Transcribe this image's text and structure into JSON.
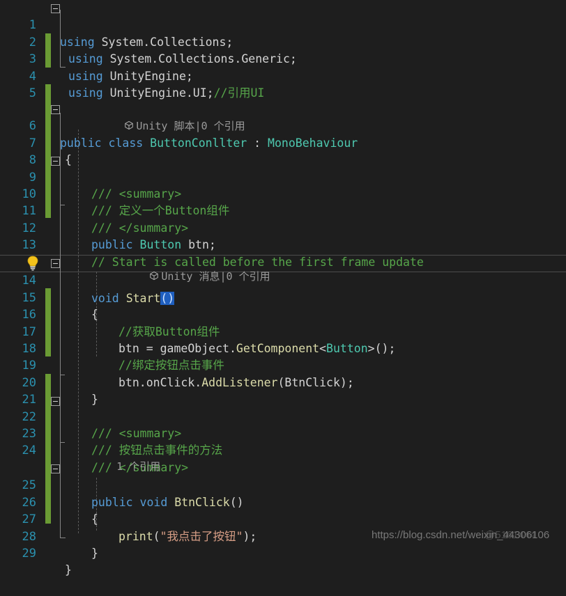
{
  "editor": {
    "theme": "visual-studio-dark",
    "background": "#1E1E1E",
    "line_number_color": "#2B91AF",
    "change_bar_color": "#6A9B34",
    "selection_color": "#1F5FBF",
    "current_line": 14
  },
  "line_numbers": {
    "n1": "1",
    "n2": "2",
    "n3": "3",
    "n4": "4",
    "n5": "5",
    "n6": "6",
    "n7": "7",
    "n8": "8",
    "n9": "9",
    "n10": "10",
    "n11": "11",
    "n12": "12",
    "n13": "13",
    "n14": "14",
    "n15": "15",
    "n16": "16",
    "n17": "17",
    "n18": "18",
    "n19": "19",
    "n20": "20",
    "n21": "21",
    "n22": "22",
    "n23": "23",
    "n24": "24",
    "n25": "25",
    "n26": "26",
    "n27": "27",
    "n28": "28",
    "n29": "29"
  },
  "codelens": {
    "class_lens": "Unity 脚本|0 个引用",
    "start_lens": "Unity 消息|0 个引用",
    "btnclick_lens": "1 个引用"
  },
  "code": {
    "l1": {
      "kw": "using",
      "rest": " System.Collections;"
    },
    "l2": {
      "kw": "using",
      "rest": " System.Collections.Generic;"
    },
    "l3": {
      "kw": "using",
      "rest": " UnityEngine;"
    },
    "l4": {
      "kw": "using",
      "rest": " UnityEngine.UI;",
      "comment": "//引用UI"
    },
    "l5": {
      "text": ""
    },
    "l6": {
      "kw1": "public",
      "kw2": "class",
      "name": "ButtonConllter",
      "colon": " : ",
      "base": "MonoBehaviour"
    },
    "l7": {
      "text": "{"
    },
    "l8": {
      "text": ""
    },
    "l9": {
      "doc": "/// <summary>"
    },
    "l10": {
      "doc": "/// 定义一个Button组件"
    },
    "l11": {
      "doc": "/// </summary>"
    },
    "l12": {
      "kw": "public",
      "type": "Button",
      "rest": " btn;"
    },
    "l13": {
      "comment": "// Start is called before the first frame update"
    },
    "l14": {
      "kw": "void",
      "name": "Start",
      "sel": "()"
    },
    "l15": {
      "text": "{"
    },
    "l16": {
      "comment": "//获取Button组件"
    },
    "l17": {
      "a": "btn = gameObject.",
      "m": "GetComponent",
      "lt": "<",
      "t": "Button",
      "gt": ">",
      "rest": "();"
    },
    "l18": {
      "comment": "//绑定按钮点击事件"
    },
    "l19": {
      "a": "btn.onClick.",
      "m": "AddListener",
      "b": "(BtnClick);"
    },
    "l20": {
      "text": "}"
    },
    "l21": {
      "text": ""
    },
    "l22": {
      "doc": "/// <summary>"
    },
    "l23": {
      "doc": "/// 按钮点击事件的方法"
    },
    "l24": {
      "doc": "/// </summary>"
    },
    "l25": {
      "kw1": "public",
      "kw2": "void",
      "name": "BtnClick",
      "rest": "()"
    },
    "l26": {
      "text": "{"
    },
    "l27": {
      "m": "print",
      "p1": "(",
      "s": "\"我点击了按钮\"",
      "p2": ");"
    },
    "l28": {
      "text": "}"
    },
    "l29": {
      "text": "}"
    }
  },
  "watermark": {
    "url": "https://blog.csdn.net/weixin_44306106",
    "overlay": "@5161444"
  }
}
